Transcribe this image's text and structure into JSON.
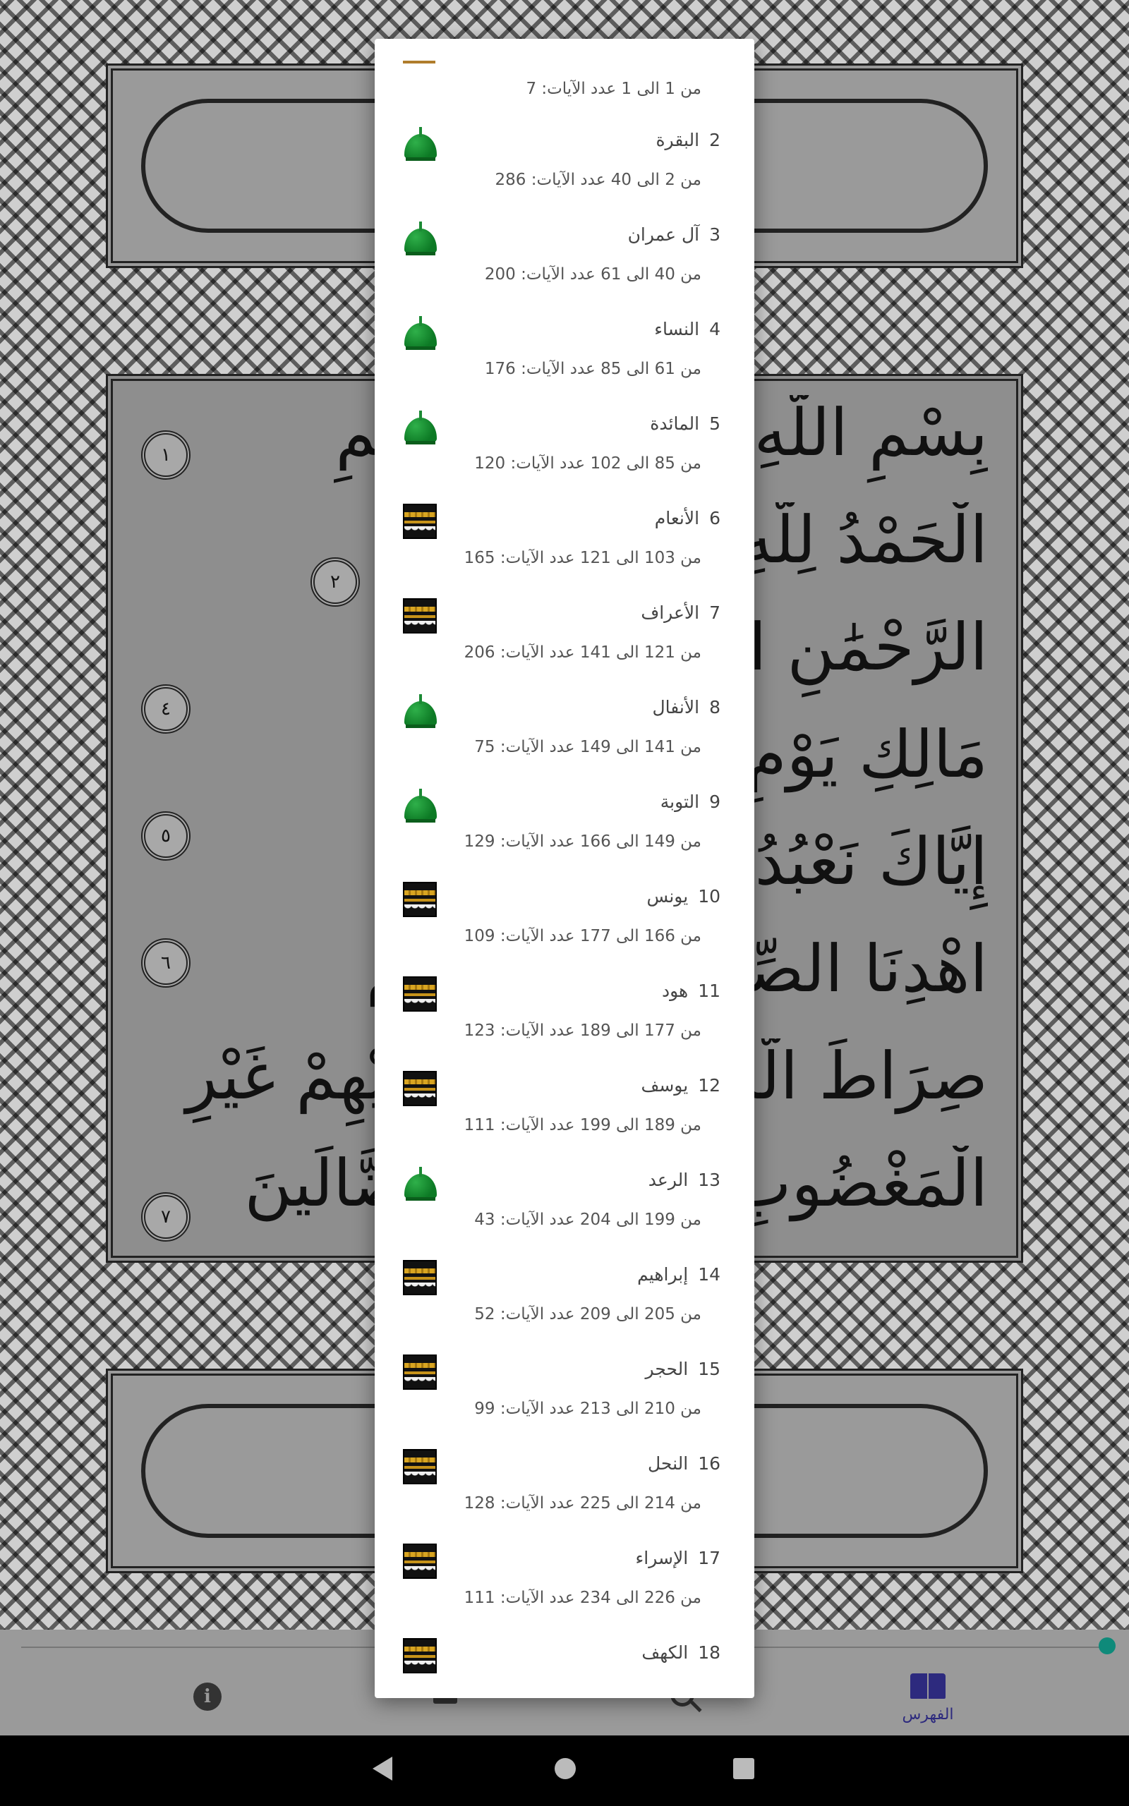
{
  "background": {
    "ayat": [
      "بِسْمِ اللَّهِ الرَّحْمَٰنِ الرَّحِيمِ",
      "الْحَمْدُ لِلَّهِ رَبِّ الْعَالَمِينَ",
      "الرَّحْمَٰنِ الرَّحِيمِ",
      "مَالِكِ يَوْمِ الدِّينِ",
      "إِيَّاكَ نَعْبُدُ وَإِيَّاكَ نَسْتَعِينُ",
      "اهْدِنَا الصِّرَاطَ الْمُسْتَقِيمَ",
      "صِرَاطَ الَّذِينَ أَنْعَمْتَ عَلَيْهِمْ غَيْرِ",
      "الْمَغْضُوبِ عَلَيْهِمْ وَلَا الضَّالِّينَ"
    ],
    "markers": [
      "١",
      "٢",
      "٤",
      "٥",
      "٦",
      "٧"
    ]
  },
  "index_dialog": {
    "first_item_info": "من 1 الى 1   عدد الآيات: 7",
    "suras": [
      {
        "number": "2",
        "name": "البقرة",
        "from": "2",
        "to": "40",
        "ayat": "286",
        "type": "medinan"
      },
      {
        "number": "3",
        "name": "آل عمران",
        "from": "40",
        "to": "61",
        "ayat": "200",
        "type": "medinan"
      },
      {
        "number": "4",
        "name": "النساء",
        "from": "61",
        "to": "85",
        "ayat": "176",
        "type": "medinan"
      },
      {
        "number": "5",
        "name": "المائدة",
        "from": "85",
        "to": "102",
        "ayat": "120",
        "type": "medinan"
      },
      {
        "number": "6",
        "name": "الأنعام",
        "from": "103",
        "to": "121",
        "ayat": "165",
        "type": "meccan"
      },
      {
        "number": "7",
        "name": "الأعراف",
        "from": "121",
        "to": "141",
        "ayat": "206",
        "type": "meccan"
      },
      {
        "number": "8",
        "name": "الأنفال",
        "from": "141",
        "to": "149",
        "ayat": "75",
        "type": "medinan"
      },
      {
        "number": "9",
        "name": "التوبة",
        "from": "149",
        "to": "166",
        "ayat": "129",
        "type": "medinan"
      },
      {
        "number": "10",
        "name": "يونس",
        "from": "166",
        "to": "177",
        "ayat": "109",
        "type": "meccan"
      },
      {
        "number": "11",
        "name": "هود",
        "from": "177",
        "to": "189",
        "ayat": "123",
        "type": "meccan"
      },
      {
        "number": "12",
        "name": "يوسف",
        "from": "189",
        "to": "199",
        "ayat": "111",
        "type": "meccan"
      },
      {
        "number": "13",
        "name": "الرعد",
        "from": "199",
        "to": "204",
        "ayat": "43",
        "type": "medinan"
      },
      {
        "number": "14",
        "name": "إبراهيم",
        "from": "205",
        "to": "209",
        "ayat": "52",
        "type": "meccan"
      },
      {
        "number": "15",
        "name": "الحجر",
        "from": "210",
        "to": "213",
        "ayat": "99",
        "type": "meccan"
      },
      {
        "number": "16",
        "name": "النحل",
        "from": "214",
        "to": "225",
        "ayat": "128",
        "type": "meccan"
      },
      {
        "number": "17",
        "name": "الإسراء",
        "from": "226",
        "to": "234",
        "ayat": "111",
        "type": "meccan"
      },
      {
        "number": "18",
        "name": "الكهف",
        "from": "",
        "to": "",
        "ayat": "",
        "type": "meccan"
      }
    ],
    "label_from": "من",
    "label_to": "الى",
    "label_ayat": "عدد الآيات:"
  },
  "bottom_bar": {
    "info_icon": "info-icon",
    "index_label": "الفهرس",
    "accent_color": "#2d2a7e"
  },
  "colors": {
    "medinan_icon": "#0d7a25",
    "meccan_icon": "#111111",
    "marker": "#b07d2c",
    "teal_dot": "#0f8a7a"
  }
}
